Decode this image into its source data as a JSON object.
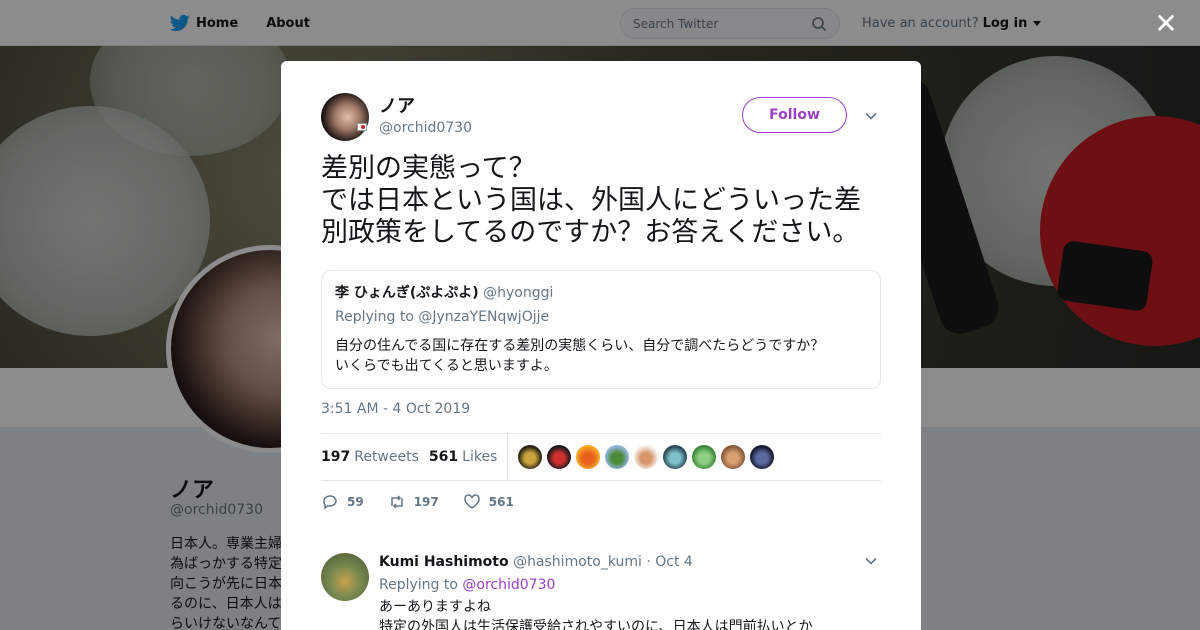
{
  "nav": {
    "home": "Home",
    "about": "About",
    "search_placeholder": "Search Twitter",
    "have_account": "Have an account?",
    "login": "Log in"
  },
  "profile": {
    "name": "ノア",
    "handle": "@orchid0730",
    "bio_lines": [
      "日本人。専業主婦",
      "為ばっかする特定",
      "向こうが先に日本",
      "るのに、日本人は",
      "らいけないなんて"
    ]
  },
  "tweet": {
    "author_name": "ノア",
    "author_handle": "@orchid0730",
    "follow_label": "Follow",
    "text_lines": [
      "差別の実態って？",
      "では日本という国は、外国人にどういった差",
      "別政策をしてるのですか？お答えください。"
    ],
    "timestamp": "3:51 AM - 4 Oct 2019",
    "retweets_count": "197",
    "retweets_label": "Retweets",
    "likes_count": "561",
    "likes_label": "Likes",
    "reply_count": "59",
    "retweet_action_count": "197",
    "like_action_count": "561"
  },
  "quote": {
    "name": "李 ひょんぎ(ぷよぷよ)",
    "handle": "@hyonggi",
    "replying_to": "Replying to @JynzaYENqwjOjje",
    "body_lines": [
      "自分の住んでる国に存在する差別の実態くらい、自分で調べたらどうですか？",
      "いくらでも出てくると思いますよ。"
    ]
  },
  "likers": [
    {
      "color": "#2a2416",
      "accent": "#c9a43a"
    },
    {
      "color": "#1a1a1a",
      "accent": "#d03030"
    },
    {
      "color": "#f5a623",
      "accent": "#e8601c"
    },
    {
      "color": "#8fb4d8",
      "accent": "#4d8a3a"
    },
    {
      "color": "#f3ece4",
      "accent": "#d8956a"
    },
    {
      "color": "#2b4a5a",
      "accent": "#7fc0c8"
    },
    {
      "color": "#3f8a3a",
      "accent": "#8fd080"
    },
    {
      "color": "#8a5a3a",
      "accent": "#d8a070"
    },
    {
      "color": "#161a30",
      "accent": "#5a6aa0"
    }
  ],
  "reply": {
    "name": "Kumi Hashimoto",
    "handle": "@hashimoto_kumi",
    "date": "· Oct 4",
    "replying_prefix": "Replying to",
    "replying_handle": "@orchid0730",
    "body_lines": [
      "あーありますよね",
      "特定の外国人は生活保護受給されやすいのに、日本人は門前払いとか"
    ]
  },
  "colors": {
    "accent": "#9b3fc4",
    "twitter_blue": "#1da1f2"
  }
}
